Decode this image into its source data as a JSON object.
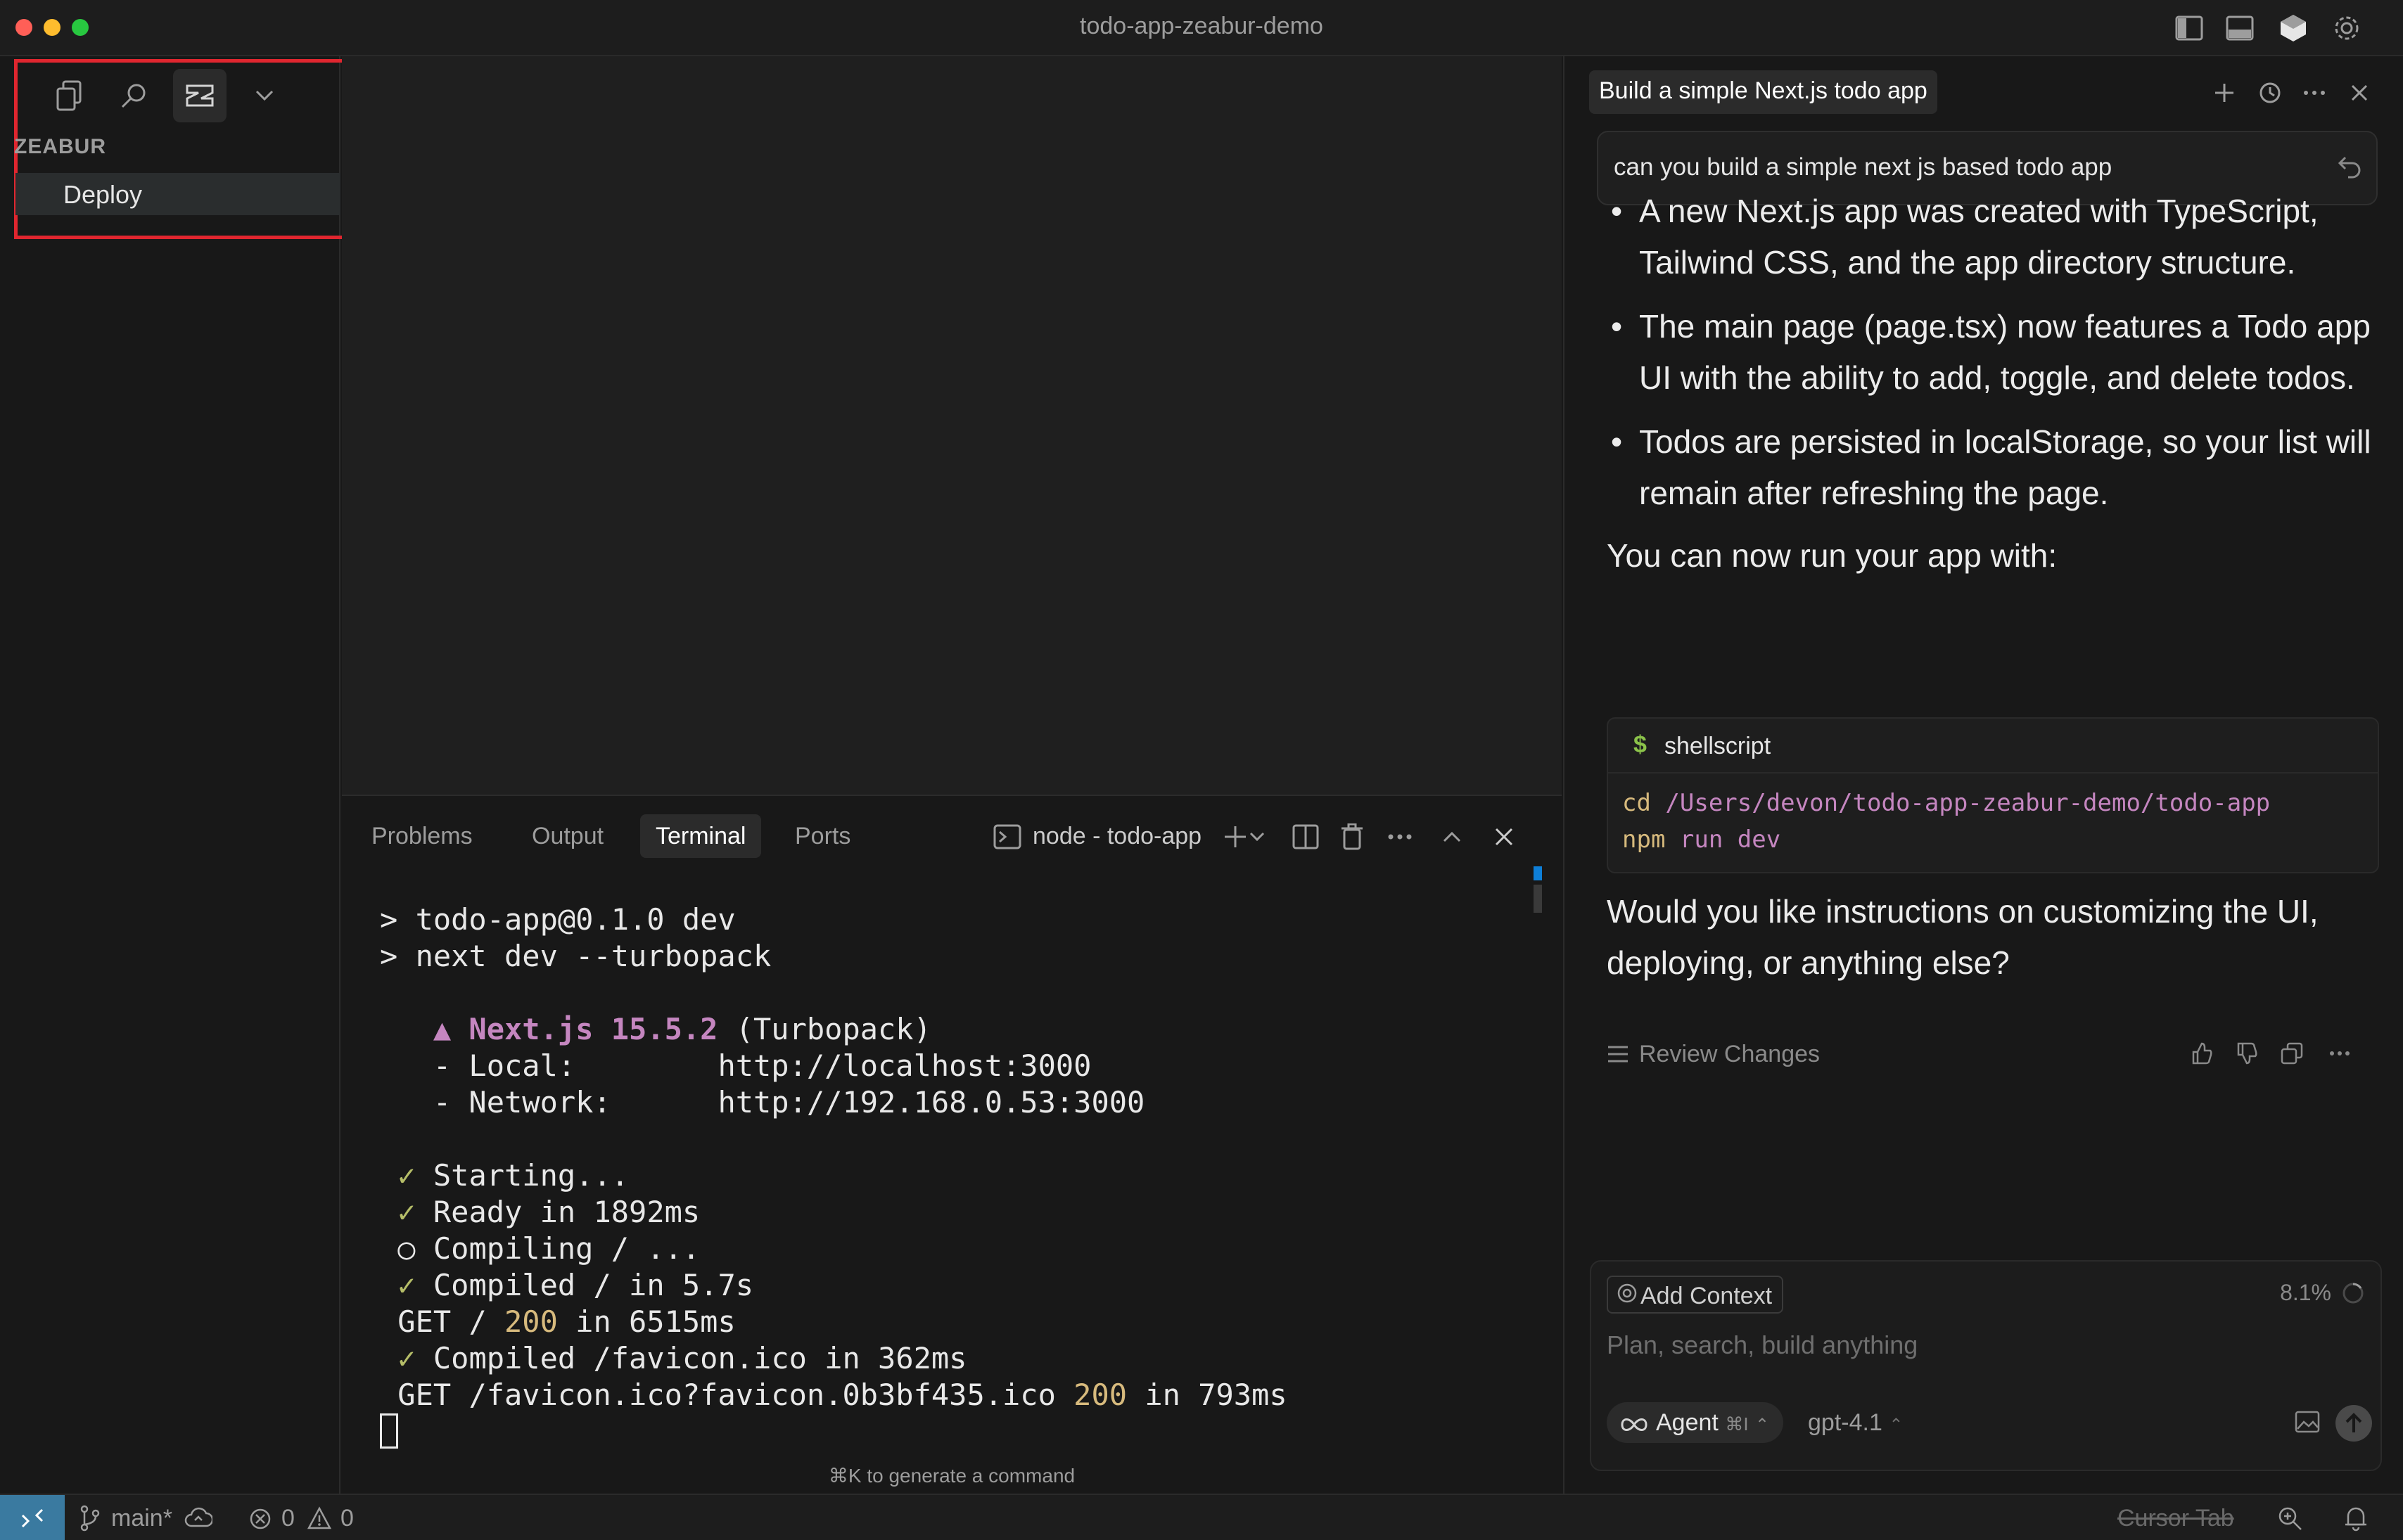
{
  "window": {
    "title": "todo-app-zeabur-demo"
  },
  "sidebar": {
    "section_title": "ZEABUR",
    "items": [
      {
        "label": "Deploy"
      }
    ]
  },
  "panel": {
    "tabs": [
      {
        "label": "Problems"
      },
      {
        "label": "Output"
      },
      {
        "label": "Terminal"
      },
      {
        "label": "Ports"
      }
    ],
    "active_tab": "Terminal",
    "terminal_name": "node - todo-app",
    "hint": "⌘K to generate a command",
    "lines": {
      "l1": "> todo-app@0.1.0 dev",
      "l2": "> next dev --turbopack",
      "l3_a": "▲ Next.js 15.5.2",
      "l3_b": " (Turbopack)",
      "l4": "- Local:        http://localhost:3000",
      "l5": "- Network:      http://192.168.0.53:3000",
      "l6_mark": "✓",
      "l6": " Starting...",
      "l7_mark": "✓",
      "l7": " Ready in 1892ms",
      "l8_mark": "○",
      "l8": " Compiling / ...",
      "l9_mark": "✓",
      "l9": " Compiled / in 5.7s",
      "l10_a": "GET / ",
      "l10_b": "200",
      "l10_c": " in 6515ms",
      "l11_mark": "✓",
      "l11": " Compiled /favicon.ico in 362ms",
      "l12_a": "GET /favicon.ico?favicon.0b3bf435.ico ",
      "l12_b": "200",
      "l12_c": " in 793ms"
    }
  },
  "chat": {
    "title": "Build a simple Next.js todo app",
    "query": "can you build a simple next js based todo app",
    "bullets": [
      "A new Next.js app was created with TypeScript, Tailwind CSS, and the app directory structure.",
      "The main page (page.tsx) now features a Todo app UI with the ability to add, toggle, and delete todos.",
      "Todos are persisted in localStorage, so your list will remain after refreshing the page."
    ],
    "run_intro": "You can now run your app with:",
    "code": {
      "lang": "shellscript",
      "line1_cmd": "cd",
      "line1_arg": " /Users/devon/todo-app-zeabur-demo/todo-app",
      "line2_cmd": "npm",
      "line2_arg": " run dev"
    },
    "question": "Would you like instructions on customizing the UI, deploying, or anything else?",
    "review_label": "Review Changes",
    "composer": {
      "add_context": "Add Context",
      "percent": "8.1%",
      "placeholder": "Plan, search, build anything",
      "agent_label": "Agent",
      "agent_shortcut": "⌘I",
      "model": "gpt-4.1"
    }
  },
  "statusbar": {
    "branch": "main*",
    "errors": "0",
    "warnings": "0",
    "cursor_tab": "Cursor Tab"
  },
  "colors": {
    "remote_button": "#3a7aa0",
    "sidebar_highlight_border": "#e0262f",
    "traffic_close": "#ff5f57",
    "traffic_min": "#febc2e",
    "traffic_max": "#28c840"
  }
}
